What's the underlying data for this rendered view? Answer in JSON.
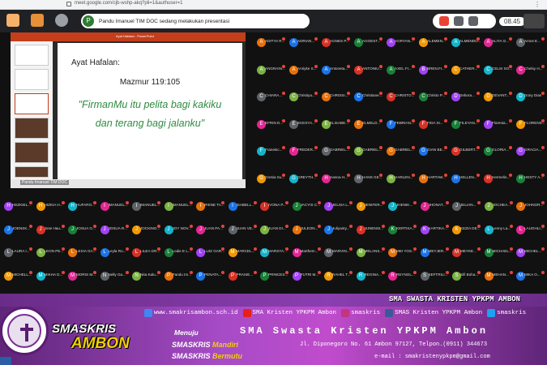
{
  "browser": {
    "url": "meet.google.com/cjb-wshp-akq?pli=1&authuser=1",
    "clock": "08.45"
  },
  "meet": {
    "presenter_avatar": "P",
    "presenter_text": "Pandu Imanuel TIM DOC sedang melakukan presentasi"
  },
  "presentation": {
    "titlebar": "Ayat Hafalan - PowerPoint",
    "slide_label": "Ayat Hafalan:",
    "slide_ref": "Mazmur 119:105",
    "slide_quote_1": "\"FirmanMu itu pelita bagi kakiku",
    "slide_quote_2": "dan terang bagi jalanku\"",
    "presenter_name": "Pandu Imanuel TIM DOC"
  },
  "participants": [
    {
      "i": "A",
      "n": "ADITYA R..."
    },
    {
      "i": "A",
      "n": "ADRIAN..."
    },
    {
      "i": "A",
      "n": "AGNES P..."
    },
    {
      "i": "A",
      "n": "AGOEST..."
    },
    {
      "i": "A",
      "n": "AGRYAN..."
    },
    {
      "i": "A",
      "n": "ALEMEN..."
    },
    {
      "i": "A",
      "n": "ALMENDO..."
    },
    {
      "i": "A",
      "n": "ALIYA G..."
    },
    {
      "i": "A",
      "n": "Amos E..."
    },
    {
      "i": "A",
      "n": "ANGRAIN..."
    },
    {
      "i": "A",
      "n": "Anriyke S..."
    },
    {
      "i": "A",
      "n": "Antoneta..."
    },
    {
      "i": "A",
      "n": "ANTONIU..."
    },
    {
      "i": "A",
      "n": "AXEL FI..."
    },
    {
      "i": "B",
      "n": "BREN.FI..."
    },
    {
      "i": "C",
      "n": "CATHER..."
    },
    {
      "i": "C",
      "n": "CELSI SO..."
    },
    {
      "i": "C",
      "n": "Chelsy H..."
    },
    {
      "i": "C",
      "n": "CHIARA..."
    },
    {
      "i": "C",
      "n": "Christiya..."
    },
    {
      "i": "C",
      "n": "CHRISSI..."
    },
    {
      "i": "C",
      "n": "Christiane..."
    },
    {
      "i": "C",
      "n": "CHRISTO..."
    },
    {
      "i": "C",
      "n": "Christo P..."
    },
    {
      "i": "D",
      "n": "Debora..."
    },
    {
      "i": "D",
      "n": "DEVANT..."
    },
    {
      "i": "D",
      "n": "Dony Dias"
    },
    {
      "i": "E",
      "n": "EFRIN D..."
    },
    {
      "i": "E",
      "n": "EKESYA..."
    },
    {
      "i": "E",
      "n": "ELISABE..."
    },
    {
      "i": "E",
      "n": "ELMELD..."
    },
    {
      "i": "F",
      "n": "FEBRIAN..."
    },
    {
      "i": "F",
      "n": "FIDA SI..."
    },
    {
      "i": "F",
      "n": "FILEYAN..."
    },
    {
      "i": "F",
      "n": "Florenia..."
    },
    {
      "i": "F",
      "n": "FLORENS..."
    },
    {
      "i": "F",
      "n": "Franeisc..."
    },
    {
      "i": "F",
      "n": "FREDER..."
    },
    {
      "i": "G",
      "n": "GABRIEL..."
    },
    {
      "i": "G",
      "n": "GABRIEL..."
    },
    {
      "i": "G",
      "n": "GABRIEL..."
    },
    {
      "i": "G",
      "n": "GIAN BE..."
    },
    {
      "i": "G",
      "n": "GILBERT..."
    },
    {
      "i": "G",
      "n": "GLORIA..."
    },
    {
      "i": "G",
      "n": "GRACIA..."
    },
    {
      "i": "G",
      "n": "Gresia Su..."
    },
    {
      "i": "G",
      "n": "GREYTH..."
    },
    {
      "i": "H",
      "n": "Hanna H..."
    },
    {
      "i": "H",
      "n": "HANS GE..."
    },
    {
      "i": "H",
      "n": "HARLEN..."
    },
    {
      "i": "H",
      "n": "HARTAW..."
    },
    {
      "i": "H",
      "n": "HELLEN..."
    },
    {
      "i": "H",
      "n": "Hermelin..."
    },
    {
      "i": "H",
      "n": "HESTY A..."
    },
    {
      "i": "H",
      "n": "HEZKIEL..."
    },
    {
      "i": "H",
      "n": "HIZKIA H..."
    },
    {
      "i": "H",
      "n": "HUFARO..."
    },
    {
      "i": "I",
      "n": "IMANUEL..."
    },
    {
      "i": "I",
      "n": "IMANUEL..."
    },
    {
      "i": "I",
      "n": "IMANUEL..."
    },
    {
      "i": "I",
      "n": "IRENE TA..."
    },
    {
      "i": "I",
      "n": "ISABELL..."
    },
    {
      "i": "I",
      "n": "IVONA P..."
    },
    {
      "i": "J",
      "n": "JACYIS C..."
    },
    {
      "i": "J",
      "n": "JELSIA L..."
    },
    {
      "i": "J",
      "n": "JENIFER..."
    },
    {
      "i": "J",
      "n": "JHENIK..."
    },
    {
      "i": "J",
      "n": "JHONAT..."
    },
    {
      "i": "J",
      "n": "JELIAN..."
    },
    {
      "i": "J",
      "n": "JOCHEA..."
    },
    {
      "i": "J",
      "n": "JOHNOR..."
    },
    {
      "i": "J",
      "n": "JOENSK..."
    },
    {
      "i": "J",
      "n": "Jose Hau..."
    },
    {
      "i": "J",
      "n": "JOSUA G..."
    },
    {
      "i": "J",
      "n": "JOSUA R..."
    },
    {
      "i": "J",
      "n": "JOCKING..."
    },
    {
      "i": "J",
      "n": "JOY NOV..."
    },
    {
      "i": "J",
      "n": "JUAN PA..."
    },
    {
      "i": "J",
      "n": "JUAN VE..."
    },
    {
      "i": "J",
      "n": "JUAN DI..."
    },
    {
      "i": "J",
      "n": "JULEON..."
    },
    {
      "i": "J",
      "n": "Juliyanty..."
    },
    {
      "i": "J",
      "n": "JUNENSI..."
    },
    {
      "i": "K",
      "n": "KERTIKA..."
    },
    {
      "i": "K",
      "n": "KARTIKA..."
    },
    {
      "i": "K",
      "n": "KEZIA DE..."
    },
    {
      "i": "L",
      "n": "Lenny La..."
    },
    {
      "i": "L",
      "n": "LAUGHLI..."
    },
    {
      "i": "L",
      "n": "LAURA I..."
    },
    {
      "i": "L",
      "n": "LEON PE..."
    },
    {
      "i": "L",
      "n": "LEXIA GA..."
    },
    {
      "i": "L",
      "n": "Leyla Ro..."
    },
    {
      "i": "L",
      "n": "LILEA GR..."
    },
    {
      "i": "L",
      "n": "Lodie E L..."
    },
    {
      "i": "L",
      "n": "LUIZ GAR..."
    },
    {
      "i": "M",
      "n": "MARCEL..."
    },
    {
      "i": "M",
      "n": "MARSYA..."
    },
    {
      "i": "M",
      "n": "Marthem..."
    },
    {
      "i": "M",
      "n": "MARVIN..."
    },
    {
      "i": "M",
      "n": "MELANS..."
    },
    {
      "i": "M",
      "n": "MEI YOS..."
    },
    {
      "i": "M",
      "n": "MEYJER..."
    },
    {
      "i": "M",
      "n": "MEYKE..."
    },
    {
      "i": "M",
      "n": "MICHAEL..."
    },
    {
      "i": "M",
      "n": "MICHEL..."
    },
    {
      "i": "M",
      "n": "MICHELL..."
    },
    {
      "i": "M",
      "n": "MIKHA D..."
    },
    {
      "i": "M",
      "n": "MORIS M..."
    },
    {
      "i": "N",
      "n": "Nelly Ga..."
    },
    {
      "i": "N",
      "n": "Nita Kalu..."
    },
    {
      "i": "P",
      "n": "Pandu Im..."
    },
    {
      "i": "P",
      "n": "PENATA..."
    },
    {
      "i": "P",
      "n": "PRAISE..."
    },
    {
      "i": "P",
      "n": "PRINCES..."
    },
    {
      "i": "P",
      "n": "PUTRI M..."
    },
    {
      "i": "R",
      "n": "RAHEL T..."
    },
    {
      "i": "R",
      "n": "REGINA..."
    },
    {
      "i": "R",
      "n": "REYNOL..."
    },
    {
      "i": "S",
      "n": "SEFTRILI..."
    },
    {
      "i": "S",
      "n": "Sifi Boha..."
    },
    {
      "i": "M",
      "n": "MEHAN..."
    },
    {
      "i": "M",
      "n": "MIKA O..."
    },
    {
      "i": "M",
      "n": "MISCHE..."
    },
    {
      "i": "N",
      "n": "NATASY..."
    },
    {
      "i": "N",
      "n": "NATASYA..."
    },
    {
      "i": "P",
      "n": "PRASETY..."
    },
    {
      "i": "P",
      "n": "PRINCES..."
    },
    {
      "i": "P",
      "n": "PUTRI M..."
    },
    {
      "i": "R",
      "n": "REGINA..."
    },
    {
      "i": "R",
      "n": "REYNOL..."
    },
    {
      "i": "R",
      "n": "RUTH T..."
    },
    {
      "i": "S",
      "n": "SEFTRI..."
    }
  ],
  "footer": {
    "marquee": "SMA SWASTA KRISTEN YPKPM AMBON",
    "website": "www.smakrisambon.sch.id",
    "youtube": "SMA Kristen YPKPM Ambon",
    "instagram": "smaskris",
    "facebook": "SMAS Kristen YPKPM Ambon",
    "twitter": "smaskris",
    "brand_1": "SMASKRIS",
    "brand_2": "AMBON",
    "menuju": "Menuju",
    "motto_1_a": "SMASKRIS",
    "motto_1_b": "Mandiri",
    "motto_2_a": "SMASKRIS",
    "motto_2_b": "Bermutu",
    "school_name": "SMA Swasta Kristen YPKPM Ambon",
    "address": "Jl. Diponegoro  No. 61 Ambon 97127, Telpon.(0911) 344673",
    "email": "e-mail : smakristenypkpm@gmail.com"
  }
}
